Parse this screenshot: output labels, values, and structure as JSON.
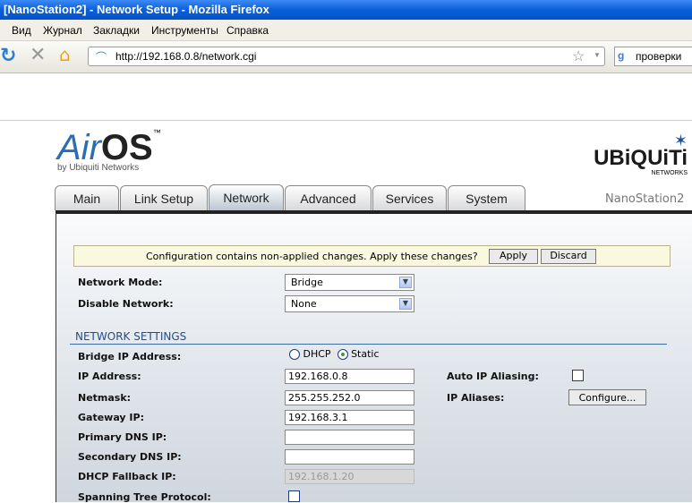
{
  "window": {
    "title": "[NanoStation2] - Network Setup - Mozilla Firefox"
  },
  "menu": [
    "Вид",
    "Журнал",
    "Закладки",
    "Инструменты",
    "Справка"
  ],
  "nav": {
    "url": "http://192.168.0.8/network.cgi",
    "search_text": "проверки"
  },
  "header": {
    "logo_air": "Air",
    "logo_os": "OS",
    "logo_tm": "™",
    "logo_by": "by Ubiquiti Networks",
    "brand": "UBiQUiTi",
    "brand_sub": "NETWORKS",
    "device": "NanoStation2"
  },
  "tabs": [
    "Main",
    "Link Setup",
    "Network",
    "Advanced",
    "Services",
    "System"
  ],
  "active_tab": "Network",
  "notice": {
    "text": "Configuration contains non-applied changes. Apply these changes?",
    "apply": "Apply",
    "discard": "Discard"
  },
  "form": {
    "network_mode_label": "Network Mode:",
    "network_mode": "Bridge",
    "disable_network_label": "Disable Network:",
    "disable_network": "None",
    "section": "NETWORK SETTINGS",
    "bridge_ip_label": "Bridge IP Address:",
    "dhcp": "DHCP",
    "static": "Static",
    "ip_label": "IP Address:",
    "ip": "192.168.0.8",
    "netmask_label": "Netmask:",
    "netmask": "255.255.252.0",
    "gateway_label": "Gateway IP:",
    "gateway": "192.168.3.1",
    "dns1_label": "Primary DNS IP:",
    "dns1": "",
    "dns2_label": "Secondary DNS IP:",
    "dns2": "",
    "fallback_label": "DHCP Fallback IP:",
    "fallback": "192.168.1.20",
    "stp_label": "Spanning Tree Protocol:",
    "auto_alias_label": "Auto IP Aliasing:",
    "aliases_label": "IP Aliases:",
    "configure": "Configure..."
  }
}
